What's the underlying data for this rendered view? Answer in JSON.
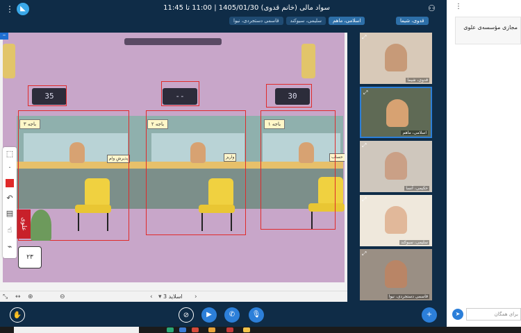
{
  "header": {
    "title": "سواد مالی (خانم قدوی) 1405/01/30 | 11:00 تا 11:45",
    "tabs": [
      {
        "label": "قدوی، شیما",
        "active": false
      },
      {
        "label": "اسلامی، ماهم",
        "active": true
      },
      {
        "label": "سلیمی، سیوکند",
        "active": false
      },
      {
        "label": "قاسمی دستجردی، نیوا",
        "active": false
      }
    ]
  },
  "slide": {
    "displays": [
      "35",
      "--",
      "30"
    ],
    "windows": [
      "باجه ۳",
      "باجه ۲",
      "باجه ۱"
    ],
    "nameplates": [
      "پذیرشِ وام",
      "واریز",
      "حساب"
    ],
    "brand": "علوی",
    "calendar_day": "۲۳",
    "label": "اسلاید 3"
  },
  "videos": [
    {
      "name": "قدوی، شیما",
      "face_color": "#c79a78",
      "bg": "#d8c9b8"
    },
    {
      "name": "اسلامی، ماهم",
      "face_color": "#d7a272",
      "bg": "#5f6a55",
      "selected": true
    },
    {
      "name": "حکیمی، آنسا",
      "face_color": "#caa086",
      "bg": "#cfc7bd"
    },
    {
      "name": "سلیمی، سیوکند",
      "face_color": "#e1b89a",
      "bg": "#efe8dc"
    },
    {
      "name": "قاسمی دستجردی، نیوا",
      "face_color": "#b98566",
      "bg": "#9a8f84"
    }
  ],
  "chat": {
    "message": "مجازی مؤسسه‌ی علوی",
    "input_placeholder": "برای همگان"
  }
}
